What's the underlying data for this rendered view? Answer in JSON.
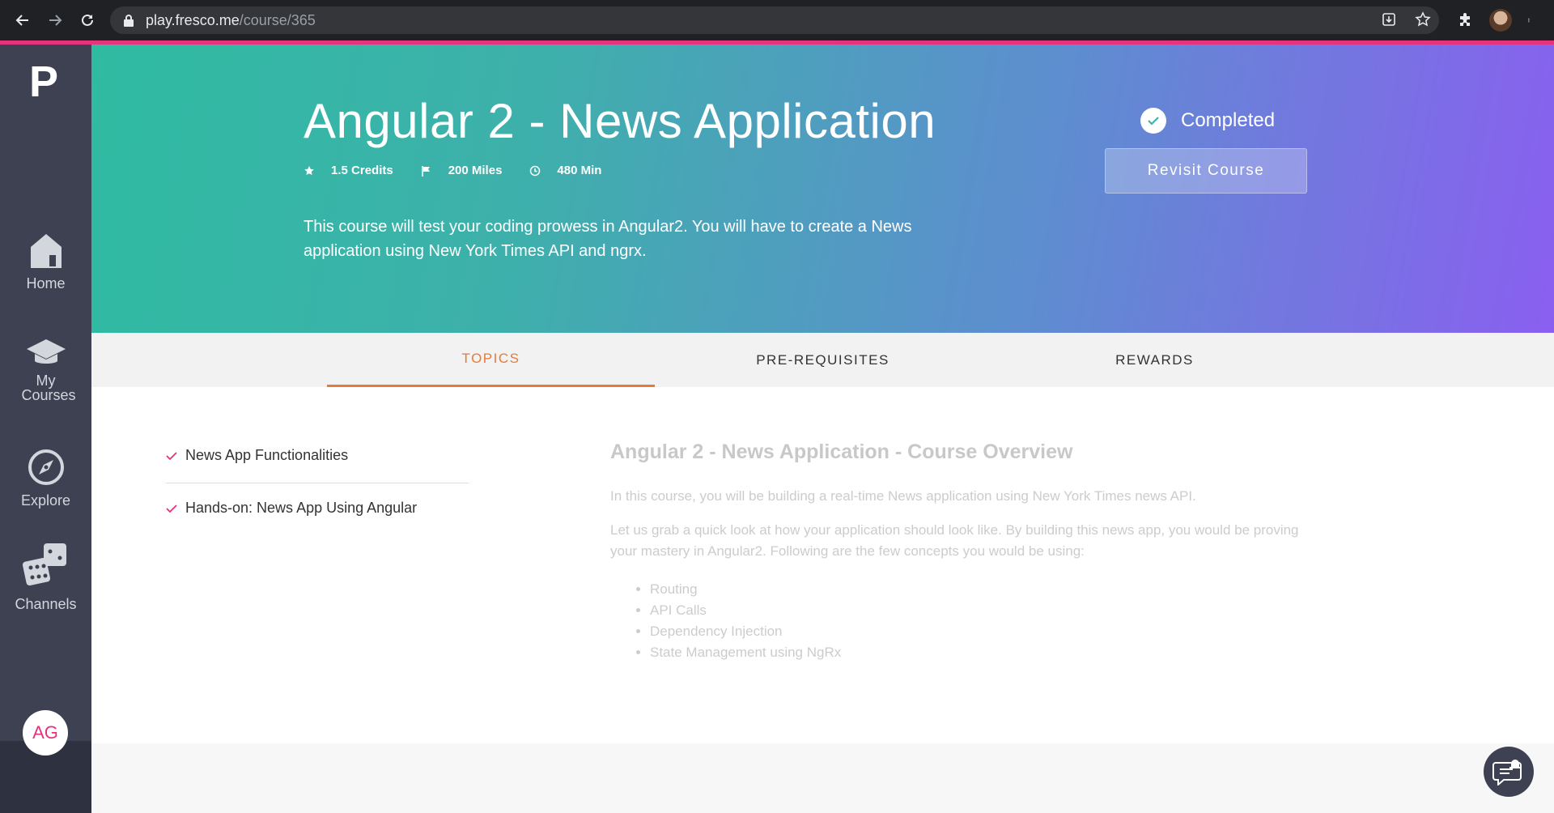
{
  "browser": {
    "url_host": "play.fresco.me",
    "url_path": "/course/365",
    "icons": [
      "back-icon",
      "forward-icon",
      "reload-icon",
      "lock-icon",
      "install-icon",
      "star-icon",
      "extensions-icon",
      "profile-icon",
      "menu-icon"
    ]
  },
  "sidebar": {
    "logo": "P",
    "items": [
      {
        "label": "Home",
        "icon": "home-icon"
      },
      {
        "label": "My Courses",
        "icon": "graduation-cap-icon"
      },
      {
        "label": "Explore",
        "icon": "compass-icon"
      },
      {
        "label": "Channels",
        "icon": "dice-icon"
      }
    ],
    "avatar_initials": "AG"
  },
  "course": {
    "title": "Angular 2 - News Application",
    "credits": "1.5 Credits",
    "miles": "200 Miles",
    "duration": "480 Min",
    "description": "This course will test your coding prowess in Angular2. You will have to create a News application using New York Times API and ngrx.",
    "status": "Completed",
    "revisit_label": "Revisit Course"
  },
  "tabs": [
    {
      "label": "TOPICS",
      "active": true
    },
    {
      "label": "PRE-REQUISITES",
      "active": false
    },
    {
      "label": "REWARDS",
      "active": false
    }
  ],
  "topics": [
    {
      "label": "News App Functionalities",
      "done": true
    },
    {
      "label": "Hands-on: News App Using Angular",
      "done": true
    }
  ],
  "overview": {
    "title": "Angular 2 - News Application - Course Overview",
    "paragraph1": "In this course, you will be building a real-time News application using New York Times news API.",
    "paragraph2": "Let us grab a quick look at how your application should look like. By building this news app, you would be proving your mastery in Angular2. Following are the few concepts you would be using:",
    "concepts": [
      "Routing",
      "API Calls",
      "Dependency Injection",
      "State Management using NgRx"
    ]
  },
  "colors": {
    "brand_pink": "#e5337d",
    "tab_active": "#e57a3a",
    "sidebar_bg": "#3d4152"
  }
}
